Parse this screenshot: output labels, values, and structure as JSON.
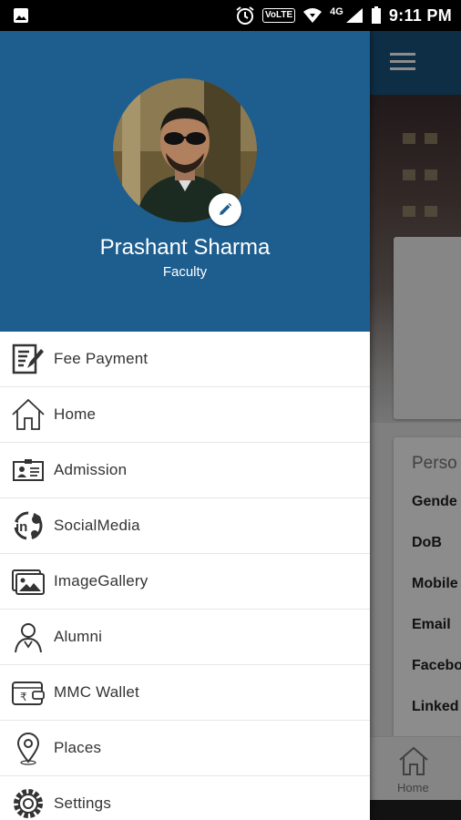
{
  "status_bar": {
    "network_small": "4G",
    "volte": "VoLTE",
    "time": "9:11 PM"
  },
  "profile": {
    "name": "Prashant Sharma",
    "role": "Faculty"
  },
  "menu": {
    "items": [
      {
        "label": "Fee Payment",
        "icon": "fee-payment-icon"
      },
      {
        "label": "Home",
        "icon": "home-icon"
      },
      {
        "label": "Admission",
        "icon": "id-card-icon"
      },
      {
        "label": "SocialMedia",
        "icon": "social-media-icon"
      },
      {
        "label": "ImageGallery",
        "icon": "image-gallery-icon"
      },
      {
        "label": "Alumni",
        "icon": "alumni-icon"
      },
      {
        "label": "MMC Wallet",
        "icon": "wallet-icon"
      },
      {
        "label": "Places",
        "icon": "location-pin-icon"
      },
      {
        "label": "Settings",
        "icon": "gear-icon"
      }
    ]
  },
  "background_screen": {
    "section_title": "Perso",
    "field_labels": [
      "Gende",
      "DoB",
      "Mobile",
      "Email",
      "Facebo",
      "Linked"
    ],
    "bottom_nav_label": "Home"
  },
  "colors": {
    "header_blue": "#1d5e8f",
    "toolbar_blue": "#1a5480",
    "icon_gray": "#333333"
  }
}
